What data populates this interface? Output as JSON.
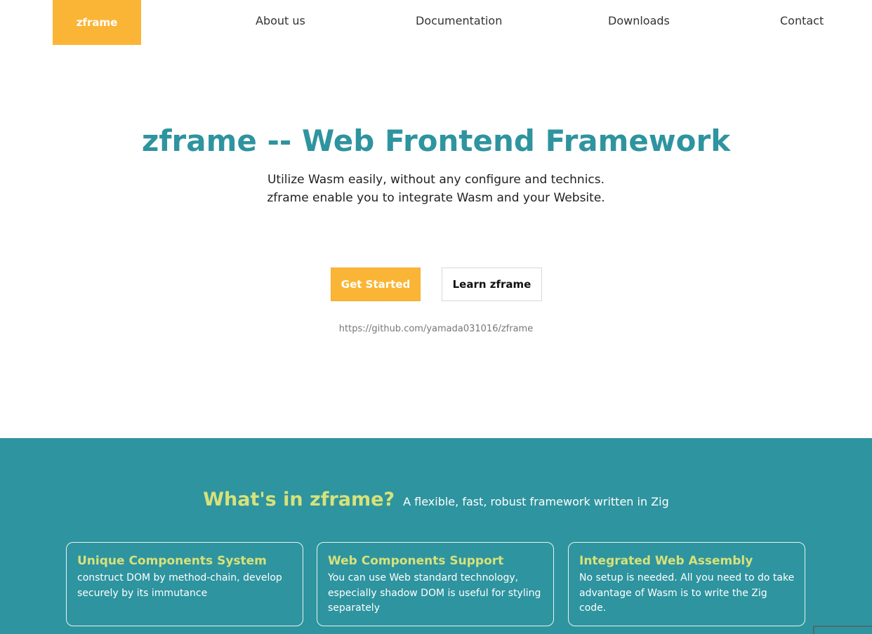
{
  "nav": {
    "logo": "zframe",
    "links": [
      "About us",
      "Documentation",
      "Downloads",
      "Contact"
    ]
  },
  "hero": {
    "title": "zframe -- Web Frontend Framework",
    "subtitle_line1": "Utilize Wasm easily, without any configure and technics.",
    "subtitle_line2": "zframe enable you to integrate Wasm and your Website.",
    "primary_button": "Get Started",
    "secondary_button": "Learn zframe",
    "repo_link": "https://github.com/yamada031016/zframe"
  },
  "features": {
    "title": "What's in zframe?",
    "subtitle": "A flexible, fast, robust framework written in Zig",
    "cards": [
      {
        "title": "Unique Components System",
        "text": "construct DOM by method-chain, develop securely by its immutance"
      },
      {
        "title": "Web Components Support",
        "text": "You can use Web standard technology, especially shadow DOM is useful for styling separately"
      },
      {
        "title": "Integrated Web Assembly",
        "text": "No setup is needed. All you need to do take advantage of Wasm is to write the Zig code."
      }
    ]
  },
  "colors": {
    "accent": "#fbb536",
    "teal": "#2e949f",
    "highlight": "#d7e27a"
  }
}
